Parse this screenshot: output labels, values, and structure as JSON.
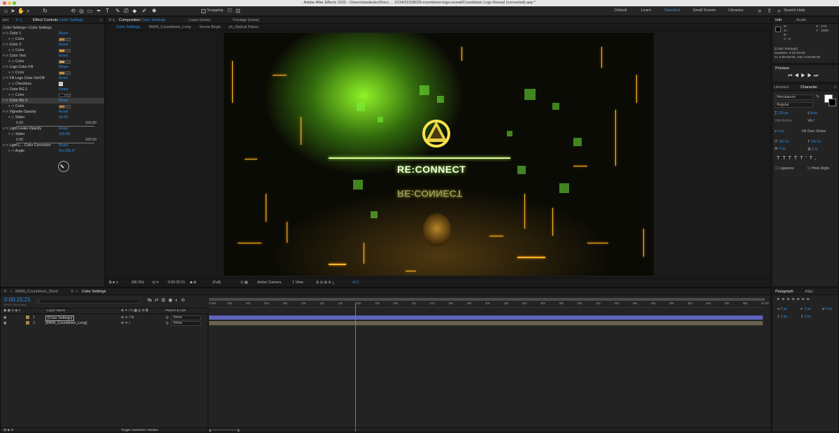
{
  "window": {
    "title": "Adobe After Effects 2020 - /Users/stanikolev/Docu ... 1/CM/22238029-countdown-logo-reveal/Countdown Logo Reveal (converted).aep *"
  },
  "toolbar": {
    "snapping_label": "Snapping",
    "workspaces": [
      "Default",
      "Learn",
      "Standard",
      "Small Screen",
      "Libraries"
    ],
    "active_workspace": "Standard",
    "search_help_placeholder": "Search Help"
  },
  "project_panel": {
    "tab_fragment": "ject"
  },
  "effect_controls": {
    "tab_prefix": "Effect Controls",
    "tab_layer": "Color Settings",
    "header": "Color Settings • Color Settings",
    "rows": [
      {
        "name": "Color 1",
        "reset": "Reset"
      },
      {
        "sub": "Color",
        "swatch": "#c87f2b"
      },
      {
        "name": "Color 2",
        "reset": "Reset"
      },
      {
        "sub": "Color",
        "swatch": "#e8962f"
      },
      {
        "name": "Color Text",
        "reset": "Reset"
      },
      {
        "sub": "Color",
        "swatch": "#d8a050"
      },
      {
        "name": "Logo Color Fill",
        "reset": "Reset"
      },
      {
        "sub": "Color",
        "swatch": "#c98a3a"
      },
      {
        "name": "Fill Logo Color On/Off",
        "reset": "Reset"
      },
      {
        "sub": "Checkbox",
        "checkbox": true
      },
      {
        "name": "Color BG 1",
        "reset": "Reset"
      },
      {
        "sub": "Color",
        "swatch": "#111111"
      },
      {
        "name": "Color BG 2",
        "reset": "Reset",
        "selected": true
      },
      {
        "sub": "Color",
        "swatch": "#b8782a"
      },
      {
        "name": "Vignette Opacity",
        "reset": "Reset"
      },
      {
        "sub": "Slider",
        "value": "58.00"
      },
      {
        "range_min": "0.00",
        "range_max": "100.00"
      },
      {
        "name": "Light Leaks Opacity",
        "reset": "Reset"
      },
      {
        "sub": "Slider",
        "value": "100.00"
      },
      {
        "range_min": "0.00",
        "range_max": "100.00"
      },
      {
        "name": "Light L... Color Correction",
        "reset": "Reset"
      },
      {
        "sub": "Angle",
        "value": "0x+136.0°"
      }
    ]
  },
  "composition": {
    "tabs": [
      {
        "label": "Composition",
        "value": "Color Settings"
      },
      {
        "label": "Layer",
        "value": "(none)"
      },
      {
        "label": "Footage",
        "value": "(none)"
      }
    ],
    "breadcrumbs": [
      "Color Settings",
      "MAIN_Countdown_Long",
      "Scene Begin",
      "sh_Optical Flares"
    ],
    "headline": "RE:CONNECT",
    "footer": {
      "zoom": "(68.3%)",
      "timecode": "0:00:15:21",
      "resolution": "(Full)",
      "camera": "Active Camera",
      "view": "1 View",
      "exposure": "+0.0"
    }
  },
  "info_panel": {
    "tabs": [
      "Info",
      "Audio"
    ],
    "lines": [
      "R :",
      "G :",
      "B :",
      "A : 0"
    ],
    "x": "X : 274",
    "y": "Y : 1084",
    "layer_info": [
      "[Color Settings]",
      "Duration: 0:01:00:00",
      "In: 0:00:00:00, Out: 0:00:59:29"
    ]
  },
  "preview_panel": {
    "title": "Preview"
  },
  "character_panel": {
    "tabs": [
      "Libraries",
      "Character"
    ],
    "font": "Herculanum",
    "style": "Regular",
    "size": "135 px",
    "leading": "Auto",
    "kerning": "Metrics",
    "tracking": "0",
    "stroke": "0 px",
    "stroke_mode": "Fill Over Stroke",
    "v_scale": "100 %",
    "h_scale": "100 %",
    "baseline": "0 px",
    "tsume": "0 %",
    "ligatures": "Ligatures",
    "hindi_digits": "Hindi Digits"
  },
  "paragraph_panel": {
    "tabs": [
      "Paragraph",
      "Align"
    ],
    "values": [
      "0 px",
      "0 px",
      "0 px",
      "0 px",
      "0 px"
    ]
  },
  "timeline": {
    "tabs": [
      "MAIN_Countdown_Short",
      "Color Settings"
    ],
    "timecode": "0:00:15:21",
    "fps": "00471 (30.00 fps)",
    "col_layer": "Layer Name",
    "col_parent": "Parent & Link",
    "layers": [
      {
        "num": "1",
        "name": "[Color Settings]",
        "parent": "None",
        "color": "#a88a58",
        "bar": "#5c63bb"
      },
      {
        "num": "2",
        "name": "[MAIN_Countdown_Long]",
        "parent": "None",
        "color": "#a8844c",
        "bar": "#6a624c"
      }
    ],
    "ruler": [
      "0:00s",
      "02s",
      "04s",
      "06s",
      "08s",
      "10s",
      "12s",
      "14s",
      "16s",
      "18s",
      "20s",
      "22s",
      "24s",
      "26s",
      "28s",
      "30s",
      "32s",
      "34s",
      "36s",
      "38s",
      "40s",
      "42s",
      "44s",
      "46s",
      "48s",
      "50s",
      "52s",
      "54s",
      "56s",
      "58s",
      "01:00"
    ],
    "toggle_label": "Toggle Switches / Modes",
    "playhead_fraction": 0.264
  },
  "colors": {
    "accent": "#2d8ceb",
    "panel": "#232323",
    "bg": "#1d1d1d"
  }
}
